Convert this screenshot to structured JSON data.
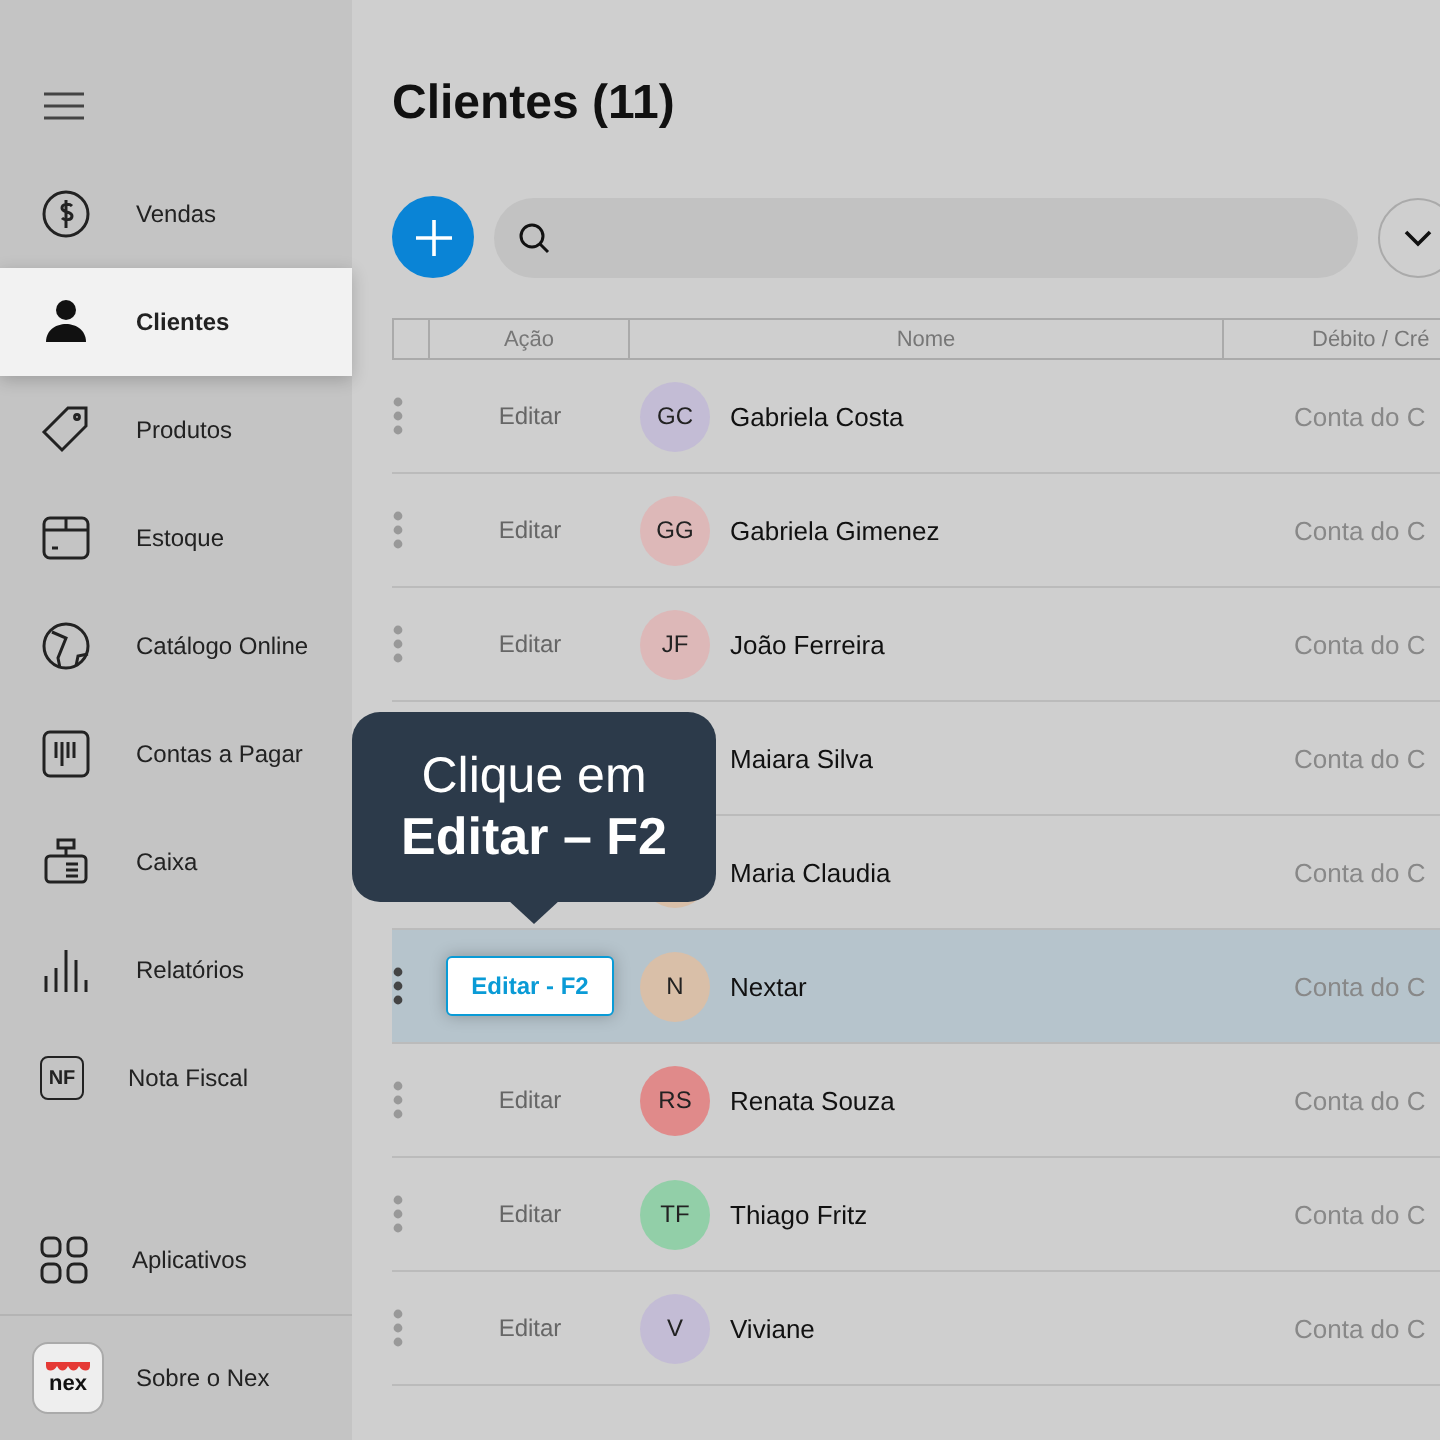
{
  "sidebar": {
    "items": [
      {
        "label": "Vendas",
        "selected": false
      },
      {
        "label": "Clientes",
        "selected": true
      },
      {
        "label": "Produtos",
        "selected": false
      },
      {
        "label": "Estoque",
        "selected": false
      },
      {
        "label": "Catálogo Online",
        "selected": false
      },
      {
        "label": "Contas a Pagar",
        "selected": false
      },
      {
        "label": "Caixa",
        "selected": false
      },
      {
        "label": "Relatórios",
        "selected": false
      },
      {
        "label": "Nota Fiscal",
        "icon_text": "NF",
        "selected": false
      }
    ],
    "apps": {
      "label": "Aplicativos"
    },
    "about": {
      "label": "Sobre o Nex",
      "logo_text": "nex"
    }
  },
  "title": "Clientes (11)",
  "table": {
    "columns": [
      "Ação",
      "Nome",
      "Débito / Cré"
    ],
    "rows": [
      {
        "action": "Editar",
        "initials": "GC",
        "color": "#c3bcd5",
        "name": "Gabriela Costa",
        "column_3": "Conta do C",
        "selected": false
      },
      {
        "action": "Editar",
        "initials": "GG",
        "color": "#ddb8b8",
        "name": "Gabriela Gimenez",
        "column_3": "Conta do C",
        "selected": false
      },
      {
        "action": "Editar",
        "initials": "JF",
        "color": "#ddb8b8",
        "name": "João Ferreira",
        "column_3": "Conta do C",
        "selected": false
      },
      {
        "name": "Maiara Silva",
        "column_3": "Conta do C",
        "selected": false
      },
      {
        "color": "#d9bfa8",
        "name": "Maria Claudia",
        "column_3": "Conta do C",
        "selected": false
      },
      {
        "action": "Editar - F2",
        "initials": "N",
        "color": "#d9bfa8",
        "name": "Nextar",
        "column_3": "Conta do C",
        "selected": true
      },
      {
        "action": "Editar",
        "initials": "RS",
        "color": "#e08a8a",
        "name": "Renata Souza",
        "column_3": "Conta do C",
        "selected": false
      },
      {
        "action": "Editar",
        "initials": "TF",
        "color": "#92cfa8",
        "name": "Thiago Fritz",
        "column_3": "Conta do C",
        "selected": false
      },
      {
        "action": "Editar",
        "initials": "V",
        "color": "#c3bcd5",
        "name": "Viviane",
        "column_3": "Conta do C",
        "selected": false
      }
    ]
  },
  "tooltip": {
    "line_1": "Clique em",
    "line_2": "Editar – F2"
  }
}
